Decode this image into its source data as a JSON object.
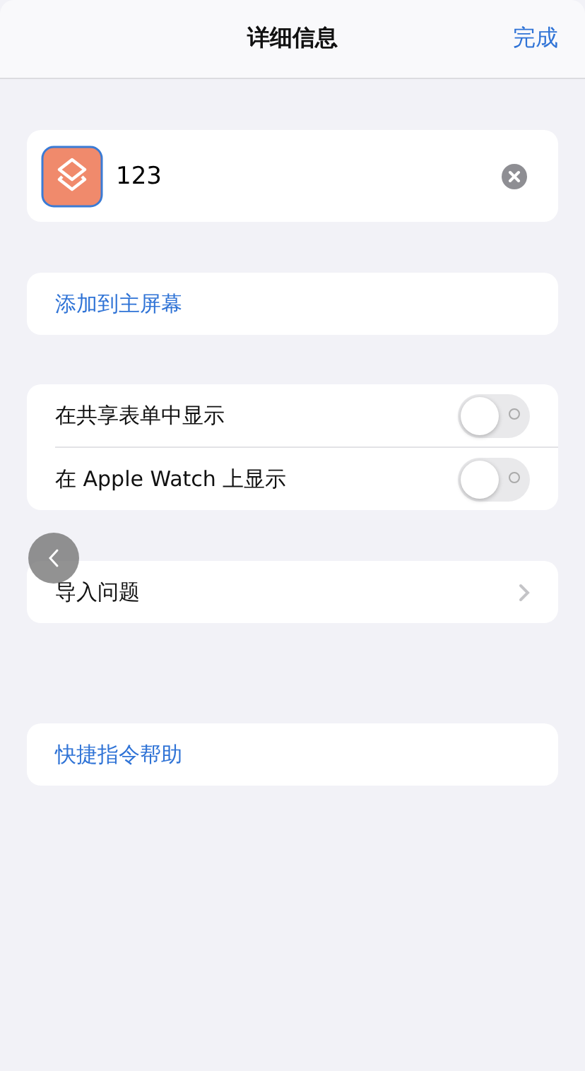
{
  "nav_bar": {
    "title": "详细信息",
    "done_button": "完成"
  },
  "name_field": {
    "value": "123"
  },
  "add_to_home": {
    "label": "添加到主屏幕"
  },
  "toggles": [
    {
      "label": "在共享表单中显示",
      "on": false
    },
    {
      "label": "在 Apple Watch 上显示",
      "on": false
    }
  ],
  "import_questions": {
    "label": "导入问题"
  },
  "help": {
    "label": "快捷指令帮助"
  }
}
